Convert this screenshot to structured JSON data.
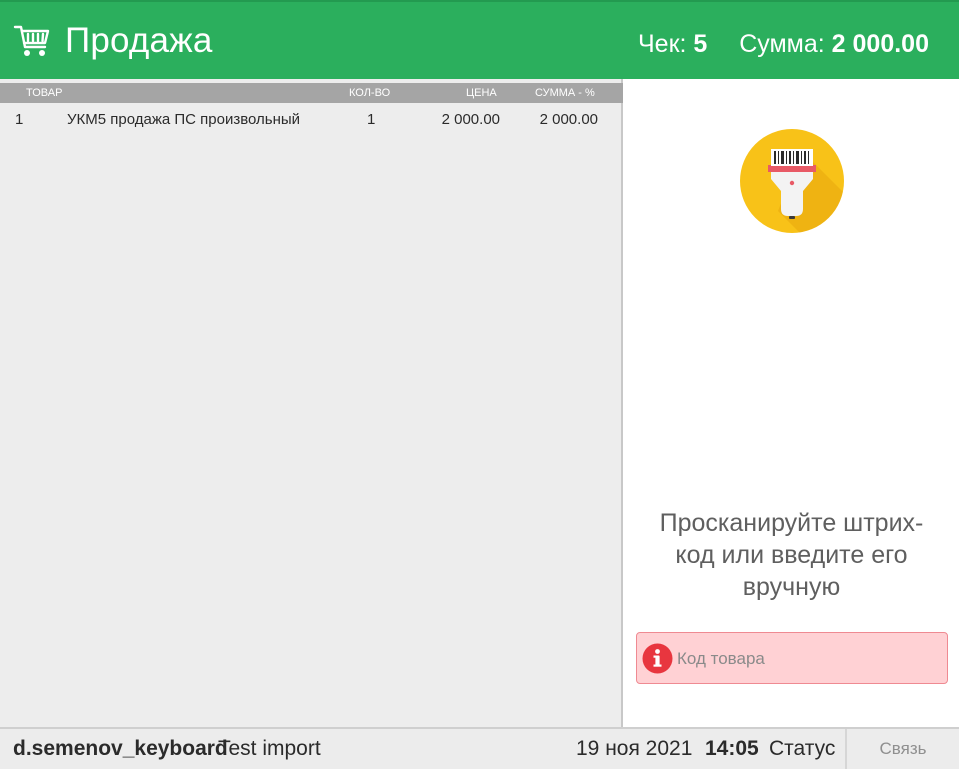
{
  "header": {
    "title": "Продажа",
    "receipt_label": "Чек:",
    "receipt_number": "5",
    "sum_label": "Сумма:",
    "sum_value": "2 000.00",
    "icon": "shopping-cart-icon",
    "background": "#2baf5d"
  },
  "table": {
    "columns": [
      "ТОВАР",
      "КОЛ-ВО",
      "ЦЕНА",
      "СУММА - %"
    ],
    "rows": [
      {
        "num": "1",
        "name": "УКМ5 продажа ПС произвольный",
        "qty": "1",
        "price": "2 000.00",
        "sum": "2 000.00"
      }
    ]
  },
  "side": {
    "scanner_icon": "barcode-scanner-icon",
    "prompt": "Просканируйте штрих-код или введите его вручную",
    "code_placeholder": "Код товара",
    "code_icon": "info-icon"
  },
  "statusbar": {
    "user": "d.semenov_keyboard",
    "store": "Test import",
    "date": "19 ноя 2021",
    "time": "14:05",
    "status": "Статус",
    "connection_button": "Связь"
  }
}
